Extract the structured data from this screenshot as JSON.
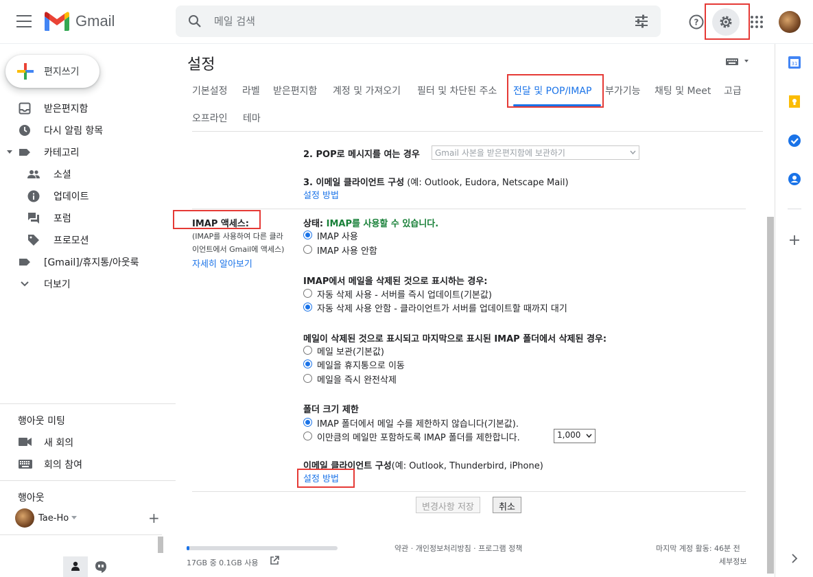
{
  "header": {
    "brand": "Gmail",
    "search_placeholder": "메일 검색"
  },
  "sidebar": {
    "compose": "편지쓰기",
    "items": [
      {
        "label": "받은편지함",
        "icon": "inbox-icon"
      },
      {
        "label": "다시 알림 항목",
        "icon": "clock-icon"
      },
      {
        "label": "카테고리",
        "icon": "label-icon"
      },
      {
        "label": "소셜",
        "icon": "people-icon"
      },
      {
        "label": "업데이트",
        "icon": "info-icon"
      },
      {
        "label": "포럼",
        "icon": "forum-icon"
      },
      {
        "label": "프로모션",
        "icon": "tag-icon"
      },
      {
        "label": "[Gmail]/휴지통/아웃룩",
        "icon": "label-icon"
      },
      {
        "label": "더보기",
        "icon": "chevron-down-icon"
      }
    ],
    "meet": {
      "title": "행아웃 미팅",
      "new_meeting": "새 회의",
      "join_meeting": "회의 참여"
    },
    "hangouts": {
      "title": "행아웃",
      "user": "Tae-Ho"
    }
  },
  "settings": {
    "title": "설정",
    "tabs": [
      "기본설정",
      "라벨",
      "받은편지함",
      "계정 및 가져오기",
      "필터 및 차단된 주소",
      "전달 및 POP/IMAP",
      "부가기능",
      "채팅 및 Meet",
      "고급",
      "오프라인",
      "테마"
    ],
    "pop": {
      "step2_label": "2. POP로 메시지를 여는 경우",
      "step2_select": "Gmail 사본을 받은편지함에 보관하기",
      "step3_label": "3. 이메일 클라이언트 구성",
      "step3_hint": " (예: Outlook, Eudora, Netscape Mail)",
      "step3_link": "설정 방법"
    },
    "imap": {
      "section_label": "IMAP 액세스:",
      "section_desc_1": "(IMAP를 사용하여 다른 클라",
      "section_desc_2": "이언트에서 Gmail에 액세스)",
      "learn_more": "자세히 알아보기",
      "status_label": "상태: ",
      "status_value": "IMAP를 사용할 수 있습니다.",
      "enable": "IMAP 사용",
      "disable": "IMAP 사용 안함",
      "deleted_title": "IMAP에서 메일을 삭제된 것으로 표시하는 경우:",
      "auto_expunge_on": "자동 삭제 사용 - 서버를 즉시 업데이트(기본값)",
      "auto_expunge_off": "자동 삭제 사용 안함 - 클라이언트가 서버를 업데이트할 때까지 대기",
      "expunge_title": "메일이 삭제된 것으로 표시되고 마지막으로 표시된 IMAP 폴더에서 삭제된 경우:",
      "archive": "메일 보관(기본값)",
      "trash": "메일을 휴지통으로 이동",
      "delete_forever": "메일을 즉시 완전삭제",
      "folder_limit_title": "폴더 크기 제한",
      "no_limit": "IMAP 폴더에서 메일 수를 제한하지 않습니다(기본값).",
      "limit": "이만큼의 메일만 포함하도록 IMAP 폴더를 제한합니다.",
      "limit_value": "1,000",
      "client_title": "이메일 클라이언트 구성",
      "client_hint": "(예: Outlook, Thunderbird, iPhone)",
      "client_link": "설정 방법"
    },
    "save": "변경사항 저장",
    "cancel": "취소"
  },
  "footer": {
    "storage": "17GB 중 0.1GB 사용",
    "storage_fraction": 0.006,
    "links": "약관 · 개인정보처리방침 · 프로그램 정책",
    "last_activity": "마지막 계정 활동: 46분 전",
    "details": "세부정보"
  }
}
